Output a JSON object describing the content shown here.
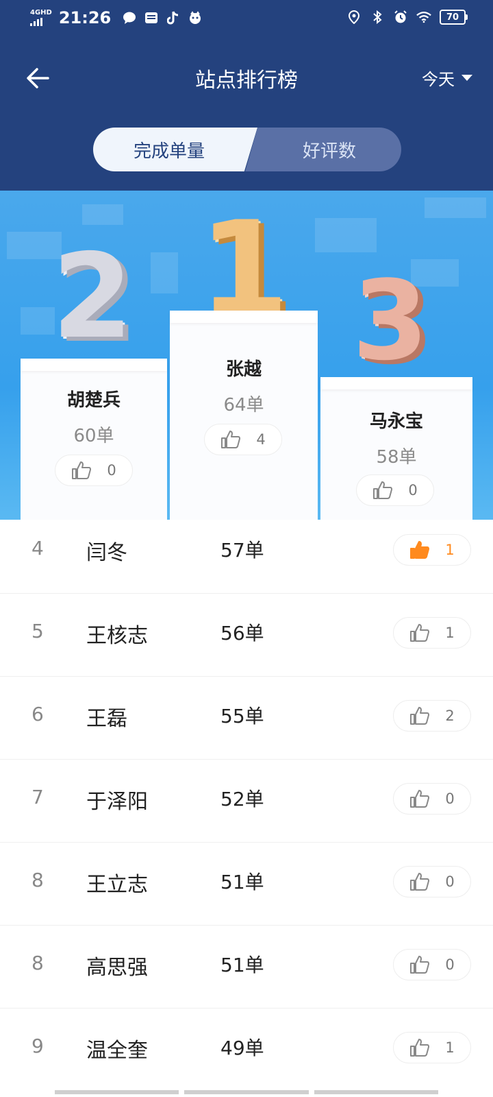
{
  "status_bar": {
    "network": "4GHD",
    "time": "21:26",
    "battery": "70"
  },
  "nav": {
    "title": "站点排行榜",
    "period": "今天"
  },
  "tabs": [
    {
      "label": "完成单量",
      "active": true
    },
    {
      "label": "好评数",
      "active": false
    }
  ],
  "podium": [
    {
      "rank": "2",
      "name": "胡楚兵",
      "count": "60单",
      "likes": "0"
    },
    {
      "rank": "1",
      "name": "张越",
      "count": "64单",
      "likes": "4"
    },
    {
      "rank": "3",
      "name": "马永宝",
      "count": "58单",
      "likes": "0"
    }
  ],
  "list": [
    {
      "rank": "4",
      "name": "闫冬",
      "count": "57单",
      "likes": "1",
      "liked": true
    },
    {
      "rank": "5",
      "name": "王核志",
      "count": "56单",
      "likes": "1",
      "liked": false
    },
    {
      "rank": "6",
      "name": "王磊",
      "count": "55单",
      "likes": "2",
      "liked": false
    },
    {
      "rank": "7",
      "name": "于泽阳",
      "count": "52单",
      "likes": "0",
      "liked": false
    },
    {
      "rank": "8",
      "name": "王立志",
      "count": "51单",
      "likes": "0",
      "liked": false
    },
    {
      "rank": "8",
      "name": "高思强",
      "count": "51单",
      "likes": "0",
      "liked": false
    },
    {
      "rank": "9",
      "name": "温全奎",
      "count": "49单",
      "likes": "1",
      "liked": false
    }
  ],
  "colors": {
    "header_bg": "#24427e",
    "sky": "#36a0ec",
    "gold": "#e2a85a",
    "silver": "#c9cbd6",
    "bronze": "#e3a592",
    "liked": "#ff8a1e"
  },
  "icons": [
    "back-arrow-icon",
    "caret-down-icon",
    "thumbs-up-icon"
  ]
}
